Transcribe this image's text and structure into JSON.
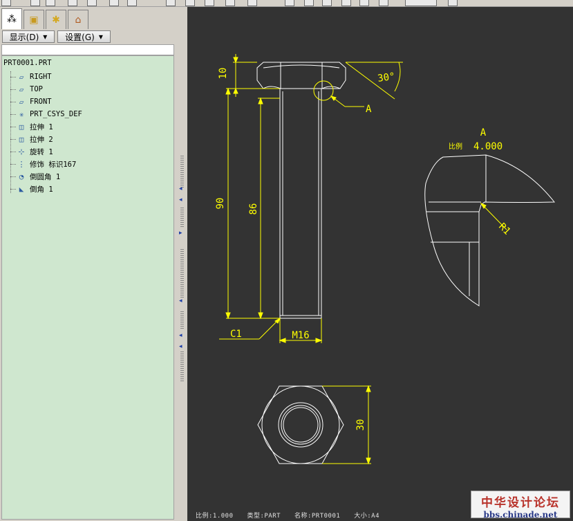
{
  "sidebar": {
    "show_menu": "显示(D)",
    "settings_menu": "设置(G)",
    "root": "PRT0001.PRT",
    "items": [
      {
        "label": "RIGHT",
        "icon": "datum-plane-icon"
      },
      {
        "label": "TOP",
        "icon": "datum-plane-icon"
      },
      {
        "label": "FRONT",
        "icon": "datum-plane-icon"
      },
      {
        "label": "PRT_CSYS_DEF",
        "icon": "coordinate-system-icon"
      },
      {
        "label": "拉伸 1",
        "icon": "extrude-icon"
      },
      {
        "label": "拉伸 2",
        "icon": "extrude-icon"
      },
      {
        "label": "旋转 1",
        "icon": "revolve-icon"
      },
      {
        "label": "修饰 标识167",
        "icon": "cosmetic-thread-icon"
      },
      {
        "label": "倒圆角 1",
        "icon": "round-icon"
      },
      {
        "label": "倒角 1",
        "icon": "chamfer-icon"
      }
    ]
  },
  "drawing": {
    "dim_head_height": "10",
    "dim_angle": "30°",
    "detail_ref": "A",
    "dim_total_length": "90",
    "dim_thread_length": "86",
    "dim_chamfer": "C1",
    "dim_thread": "M16",
    "detail_title": "A",
    "detail_scale_label": "比例",
    "detail_scale_value": "4.000",
    "dim_radius": "R1",
    "dim_hex_width": "30"
  },
  "statusbar": {
    "scale": "比例:1.000",
    "type": "类型:PART",
    "name": "名称:PRT0001",
    "size": "大小:A4"
  },
  "watermark": {
    "line1": "中华设计论坛",
    "line2": "bbs.chinade.net"
  },
  "colors": {
    "canvas_bg": "#333333",
    "geometry": "#ffffff",
    "dimension": "#ffff00",
    "tree_bg": "#cfe7cf"
  }
}
